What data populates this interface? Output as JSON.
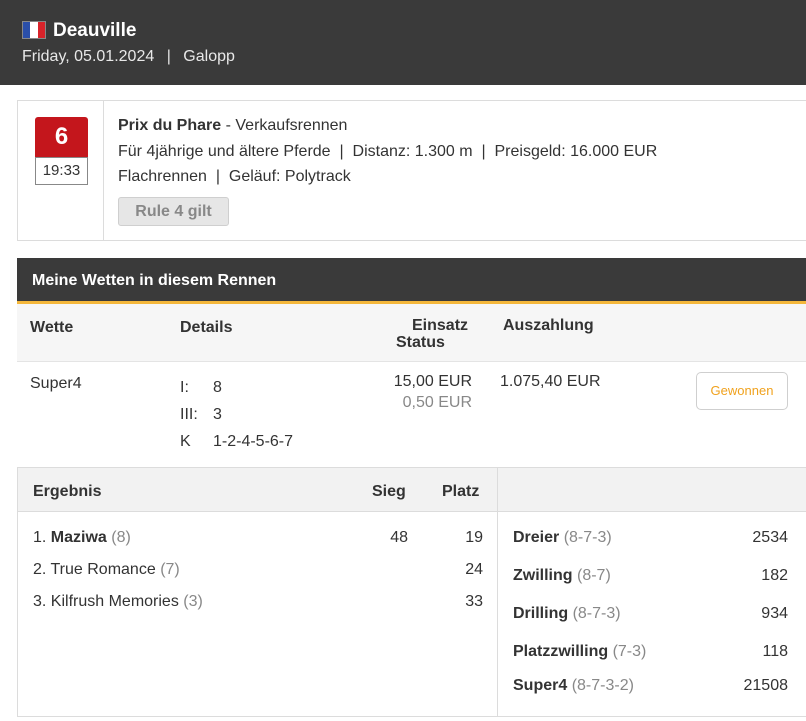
{
  "header": {
    "venue": "Deauville",
    "date": "Friday, 05.01.2024",
    "sep": "|",
    "type": "Galopp",
    "flag": "france-flag"
  },
  "race": {
    "number": "6",
    "time": "19:33",
    "name": "Prix du Phare",
    "category": " - Verkaufsrennen",
    "line1": "Für 4jährige und ältere Pferde  |  Distanz: 1.300 m  |  Preisgeld: 16.000 EUR",
    "line2": "Flachrennen  |  Geläuf: Polytrack",
    "rule": "Rule 4 gilt"
  },
  "bets": {
    "title": "Meine Wetten in diesem Rennen",
    "col_bet": "Wette",
    "col_details": "Details",
    "col_stake": "Einsatz",
    "col_status": "Status",
    "col_payout": "Auszahlung",
    "row": {
      "bet": "Super4",
      "details": [
        {
          "k": "I:",
          "v": "8"
        },
        {
          "k": "III:",
          "v": "3"
        },
        {
          "k": "K",
          "v": "1-2-4-5-6-7"
        }
      ],
      "stake": "15,00 EUR",
      "stake2": "0,50 EUR",
      "payout": "1.075,40 EUR",
      "status": "Gewonnen"
    }
  },
  "results": {
    "col_result": "Ergebnis",
    "col_win": "Sieg",
    "col_place": "Platz",
    "horses": [
      {
        "pos": "1.",
        "name": "Maziwa",
        "num": "(8)",
        "win": "48",
        "place": "19",
        "bold": true
      },
      {
        "pos": "2.",
        "name": "True Romance",
        "num": "(7)",
        "win": "",
        "place": "24",
        "bold": false
      },
      {
        "pos": "3.",
        "name": "Kilfrush Memories",
        "num": "(3)",
        "win": "",
        "place": "33",
        "bold": false
      }
    ],
    "odds": [
      {
        "name": "Dreier",
        "combo": "(8-7-3)",
        "value": "2534"
      },
      {
        "name": "Zwilling",
        "combo": "(8-7)",
        "value": "182"
      },
      {
        "name": "Drilling",
        "combo": "(8-7-3)",
        "value": "934"
      },
      {
        "name": "Platzzwilling",
        "combo": "(7-3)",
        "value": "118"
      },
      {
        "name": "Super4",
        "combo": "(8-7-3-2)",
        "value": "21508"
      }
    ]
  },
  "colors": {
    "accent": "#f4b73b",
    "race_red": "#c4161c",
    "won": "#f0a21e",
    "header_bg": "#3a3a3a"
  }
}
